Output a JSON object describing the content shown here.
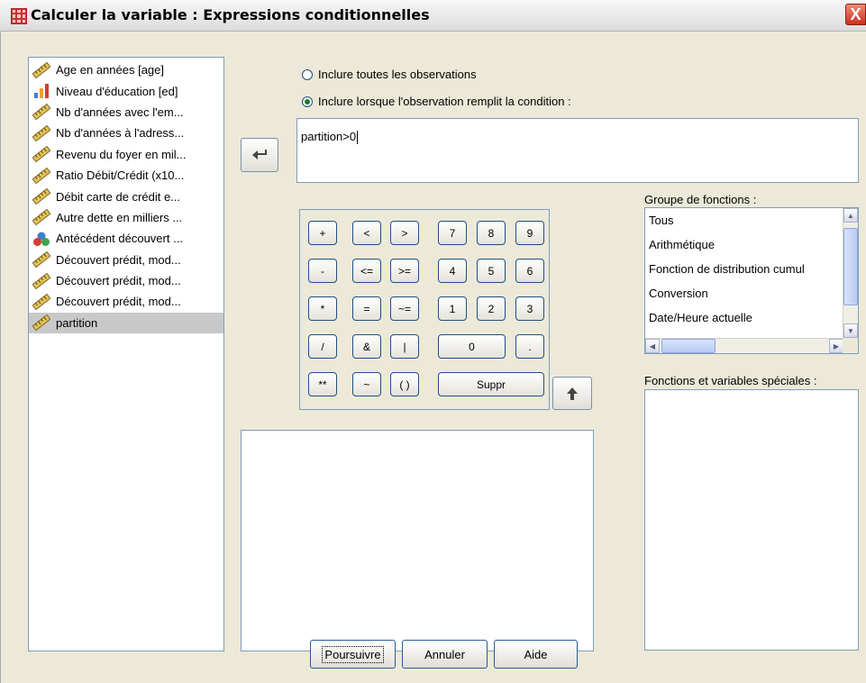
{
  "window": {
    "title": "Calculer la variable : Expressions conditionnelles",
    "close_label": "X"
  },
  "variables": [
    {
      "label": "Age en années [age]",
      "icon": "scale-ruler"
    },
    {
      "label": "Niveau d'éducation [ed]",
      "icon": "ordinal-bars"
    },
    {
      "label": "Nb d'années avec l'em...",
      "icon": "scale-ruler"
    },
    {
      "label": "Nb d'années à l'adress...",
      "icon": "scale-ruler"
    },
    {
      "label": "Revenu du foyer en mil...",
      "icon": "scale-ruler"
    },
    {
      "label": "Ratio Débit/Crédit  (x10...",
      "icon": "scale-ruler"
    },
    {
      "label": "Débit carte de crédit e...",
      "icon": "scale-ruler"
    },
    {
      "label": "Autre dette en milliers ...",
      "icon": "scale-ruler"
    },
    {
      "label": "Antécédent découvert ...",
      "icon": "nominal-circles"
    },
    {
      "label": "Découvert prédit, mod...",
      "icon": "scale-ruler"
    },
    {
      "label": "Découvert prédit, mod...",
      "icon": "scale-ruler"
    },
    {
      "label": "Découvert prédit, mod...",
      "icon": "scale-ruler"
    },
    {
      "label": "partition",
      "icon": "scale-ruler",
      "selected": true
    }
  ],
  "radios": {
    "all_cases": {
      "label": "Inclure toutes les observations",
      "checked": false
    },
    "condition": {
      "label": "Inclure lorsque l'observation remplit la condition :",
      "checked": true
    }
  },
  "condition_text": "partition>0",
  "keypad": {
    "plus": "+",
    "lt": "<",
    "gt": ">",
    "k7": "7",
    "k8": "8",
    "k9": "9",
    "minus": "-",
    "le": "<=",
    "ge": ">=",
    "k4": "4",
    "k5": "5",
    "k6": "6",
    "mult": "*",
    "eq": "=",
    "ne": "~=",
    "k1": "1",
    "k2": "2",
    "k3": "3",
    "div": "/",
    "and": "&",
    "or": "|",
    "k0": "0",
    "dot": ".",
    "pow": "**",
    "not": "~",
    "parens": "( )",
    "delete": "Suppr"
  },
  "function_group": {
    "label": "Groupe de fonctions :",
    "items": [
      "Tous",
      "Arithmétique",
      "Fonction de distribution cumul",
      "Conversion",
      "Date/Heure actuelle"
    ]
  },
  "special_functions": {
    "label": "Fonctions et variables spéciales :"
  },
  "buttons": {
    "continue": "Poursuivre",
    "cancel": "Annuler",
    "help": "Aide"
  },
  "colors": {
    "dialog_bg": "#ece9d8",
    "border": "#7f9db9",
    "selected_row": "#c8c8c8",
    "radio_dot": "#1c7a2a"
  }
}
